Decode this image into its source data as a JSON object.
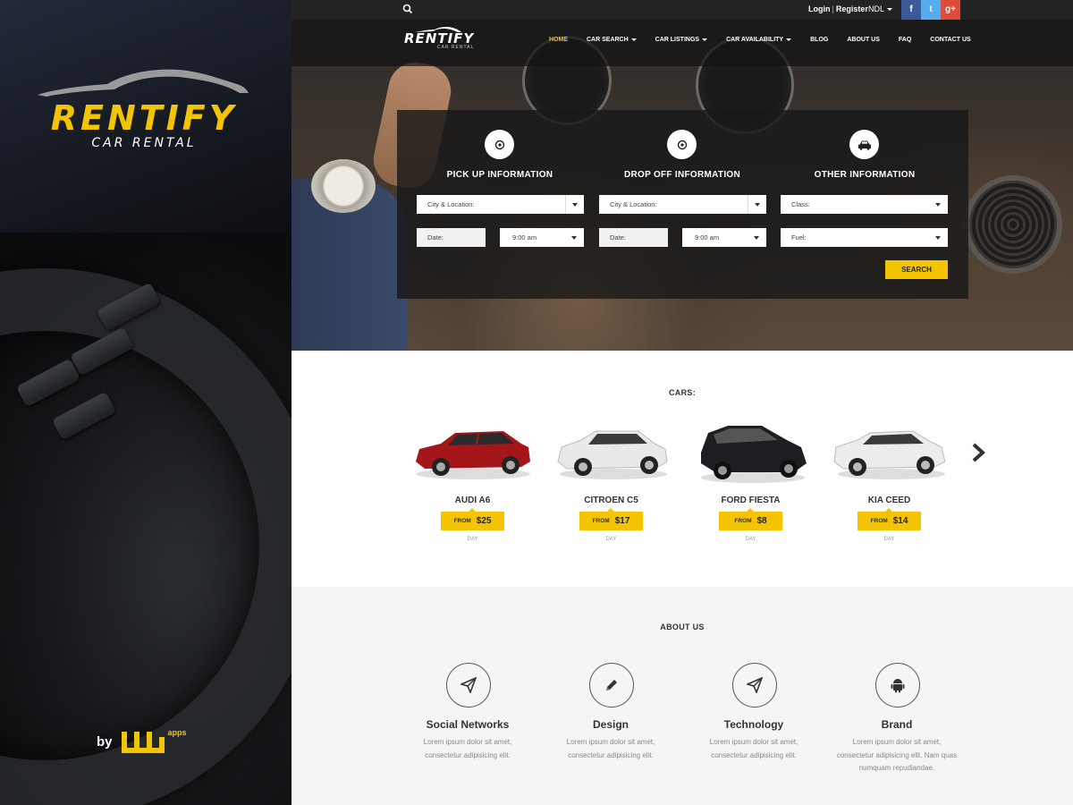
{
  "brand": {
    "title": "RENTIFY",
    "subtitle": "CAR RENTAL",
    "by_label": "by",
    "vendor_suffix": "apps"
  },
  "topbar": {
    "login_label": "Login",
    "separator": "|",
    "register_label": "Register",
    "language": "NDL",
    "social": [
      {
        "icon": "facebook-icon",
        "glyph": "f",
        "color": "#3b5998"
      },
      {
        "icon": "twitter-icon",
        "glyph": "t",
        "color": "#55acee"
      },
      {
        "icon": "google-plus-icon",
        "glyph": "g+",
        "color": "#dd4b39"
      }
    ]
  },
  "nav": {
    "logo_title": "RENTIFY",
    "logo_subtitle": "CAR RENTAL",
    "items": [
      {
        "label": "HOME",
        "active": true,
        "dropdown": false
      },
      {
        "label": "CAR SEARCH",
        "active": false,
        "dropdown": true
      },
      {
        "label": "CAR LISTINGS",
        "active": false,
        "dropdown": true
      },
      {
        "label": "CAR AVAILABILITY",
        "active": false,
        "dropdown": true
      },
      {
        "label": "BLOG",
        "active": false,
        "dropdown": false
      },
      {
        "label": "ABOUT US",
        "active": false,
        "dropdown": false
      },
      {
        "label": "FAQ",
        "active": false,
        "dropdown": false
      },
      {
        "label": "CONTACT US",
        "active": false,
        "dropdown": false
      }
    ]
  },
  "search": {
    "columns": [
      {
        "title": "PICK UP INFORMATION",
        "icon": "location-pin-icon"
      },
      {
        "title": "DROP OFF INFORMATION",
        "icon": "location-pin-icon"
      },
      {
        "title": "OTHER INFORMATION",
        "icon": "car-icon"
      }
    ],
    "pickup": {
      "location": "City & Location:",
      "date": "Date:",
      "time": "9:00 am"
    },
    "dropoff": {
      "location": "City & Location:",
      "date": "Date:",
      "time": "9:00 am"
    },
    "other": {
      "class": "Class:",
      "fuel": "Fuel:"
    },
    "button_label": "SEARCH"
  },
  "cars": {
    "title": "CARS:",
    "from_label": "FROM",
    "unit_label": "DAY",
    "items": [
      {
        "name": "AUDI A6",
        "price": "$25",
        "color": "#a4161a"
      },
      {
        "name": "CITROEN C5",
        "price": "$17",
        "color": "#e9e9e9"
      },
      {
        "name": "FORD FIESTA",
        "price": "$8",
        "color": "#1e1e22"
      },
      {
        "name": "KIA CEED",
        "price": "$14",
        "color": "#ececec"
      }
    ]
  },
  "about": {
    "title": "ABOUT US",
    "features": [
      {
        "title": "Social Networks",
        "icon": "paper-plane-icon",
        "line1": "Lorem ipsum dolor sit amet,",
        "line2": "consectetur adipisicing elit.",
        "line3": ""
      },
      {
        "title": "Design",
        "icon": "pencil-icon",
        "line1": "Lorem ipsum dolor sit amet,",
        "line2": "consectetur adipisicing elit.",
        "line3": ""
      },
      {
        "title": "Technology",
        "icon": "paper-plane-icon",
        "line1": "Lorem ipsum dolor sit amet,",
        "line2": "consectetur adipisicing elit.",
        "line3": ""
      },
      {
        "title": "Brand",
        "icon": "android-icon",
        "line1": "Lorem ipsum dolor sit amet,",
        "line2": "consectetur adipisicing elit. Nam quas",
        "line3": "numquam repudiandae."
      }
    ]
  },
  "colors": {
    "accent": "#f5c400",
    "dark": "#232323"
  }
}
